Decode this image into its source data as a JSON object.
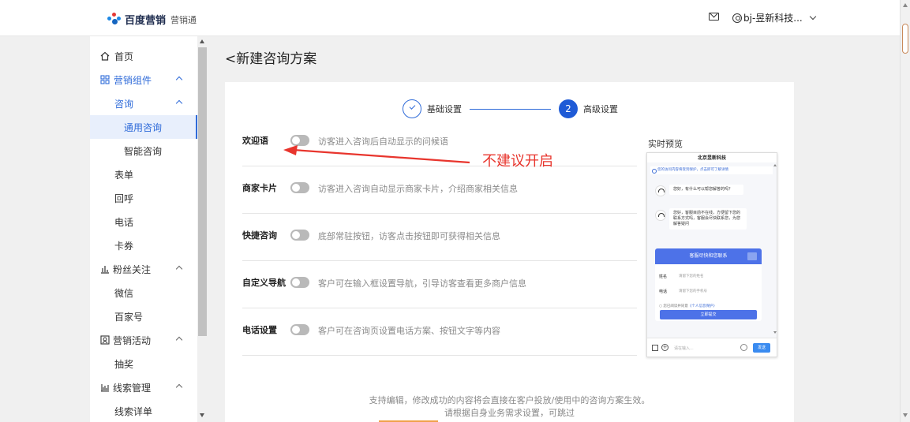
{
  "header": {
    "brand": "百度营销",
    "product": "营销通",
    "user": "bj-昱新科技..."
  },
  "sidebar": {
    "items": [
      {
        "label": "首页"
      },
      {
        "label": "营销组件"
      },
      {
        "label": "咨询"
      },
      {
        "label": "通用咨询"
      },
      {
        "label": "智能咨询"
      },
      {
        "label": "表单"
      },
      {
        "label": "回呼"
      },
      {
        "label": "电话"
      },
      {
        "label": "卡券"
      },
      {
        "label": "粉丝关注"
      },
      {
        "label": "微信"
      },
      {
        "label": "百家号"
      },
      {
        "label": "营销活动"
      },
      {
        "label": "抽奖"
      },
      {
        "label": "线索管理"
      },
      {
        "label": "线索详单"
      }
    ]
  },
  "page": {
    "title": "新建咨询方案"
  },
  "steps": [
    {
      "label": "基础设置"
    },
    {
      "label": "高级设置",
      "number": "2"
    }
  ],
  "options": [
    {
      "label": "欢迎语",
      "desc": "访客进入咨询后自动显示的问候语",
      "enabled": false
    },
    {
      "label": "商家卡片",
      "desc": "访客进入咨询自动显示商家卡片，介绍商家相关信息",
      "enabled": false
    },
    {
      "label": "快捷咨询",
      "desc": "底部常驻按钮，访客点击按钮即可获得相关信息",
      "enabled": false
    },
    {
      "label": "自定义导航",
      "desc": "客户可在输入框设置导航，引导访客查看更多商户信息",
      "enabled": false
    },
    {
      "label": "电话设置",
      "desc": "客户可在咨询页设置电话方案、按钮文字等内容",
      "enabled": false
    }
  ],
  "annotation": "不建议开启",
  "preview": {
    "title": "实时预览",
    "company": "北京昱新科技",
    "notice": "您的访问内容将受到保护，点击即可了解详情",
    "msg1": "您好，有什么可以帮您解答的吗？",
    "msg2": "您好，客服目前不在线，方便留下您的联系方式吗，客服会尽快联系您，为您解答疑问",
    "form_title": "客服尽快和您联系",
    "name_label": "姓名",
    "name_placeholder": "请留下您的姓名",
    "phone_label": "电话",
    "phone_placeholder": "请留下您的手机号",
    "agree_text": "您已阅读并同意",
    "agree_link": "《个人信息保护》",
    "submit": "立即提交",
    "input_placeholder": "请在输入...",
    "send": "发送"
  },
  "footer": {
    "line1": "支持编辑，修改成功的内容将会直接在客户投放/使用中的咨询方案生效。",
    "line2": "请根据自身业务需求设置，可跳过"
  },
  "colors": {
    "primary": "#2f6bd9",
    "annotation": "#e8352d"
  }
}
